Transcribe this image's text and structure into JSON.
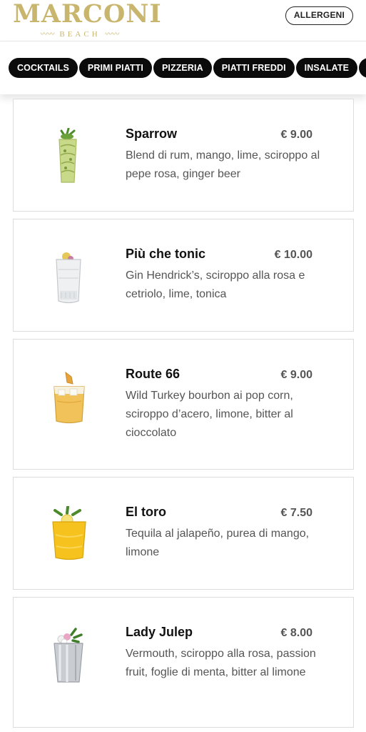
{
  "header": {
    "logo_text": "MARCONI",
    "logo_sub": "BEACH",
    "logo_wave": "〰〰",
    "allergeni_label": "ALLERGENI"
  },
  "categories": [
    "COCKTAILS",
    "PRIMI PIATTI",
    "PIZZERIA",
    "PIATTI FREDDI",
    "INSALATE",
    "B"
  ],
  "colors": {
    "brand_gold": "#c9b66e",
    "pill_bg": "#0b0b0b",
    "text_muted": "#555555",
    "card_border": "#dcdcdc"
  },
  "items": [
    {
      "name": "Sparrow",
      "price": "€ 9.00",
      "description": "Blend di rum, mango, lime, sciroppo al pepe rosa, ginger beer",
      "icon": "green-tiki-cocktail-icon"
    },
    {
      "name": "Più che tonic",
      "price": "€ 10.00",
      "description": "Gin Hendrick’s, sciroppo alla rosa e cetriolo, lime, tonica",
      "icon": "gin-tonic-glass-icon"
    },
    {
      "name": "Route 66",
      "price": "€ 9.00",
      "description": "Wild Turkey bourbon ai pop corn, sciroppo d’acero, limone, bitter al cioccolato",
      "icon": "amber-rocks-cocktail-icon"
    },
    {
      "name": "El toro",
      "price": "€ 7.50",
      "description": "Tequila al jalapeño, purea di mango, limone",
      "icon": "yellow-cocktail-icon"
    },
    {
      "name": "Lady Julep",
      "price": "€ 8.00",
      "description": "Vermouth, sciroppo alla rosa, passion fruit, foglie di menta, bitter al limone",
      "icon": "julep-cup-icon"
    }
  ]
}
